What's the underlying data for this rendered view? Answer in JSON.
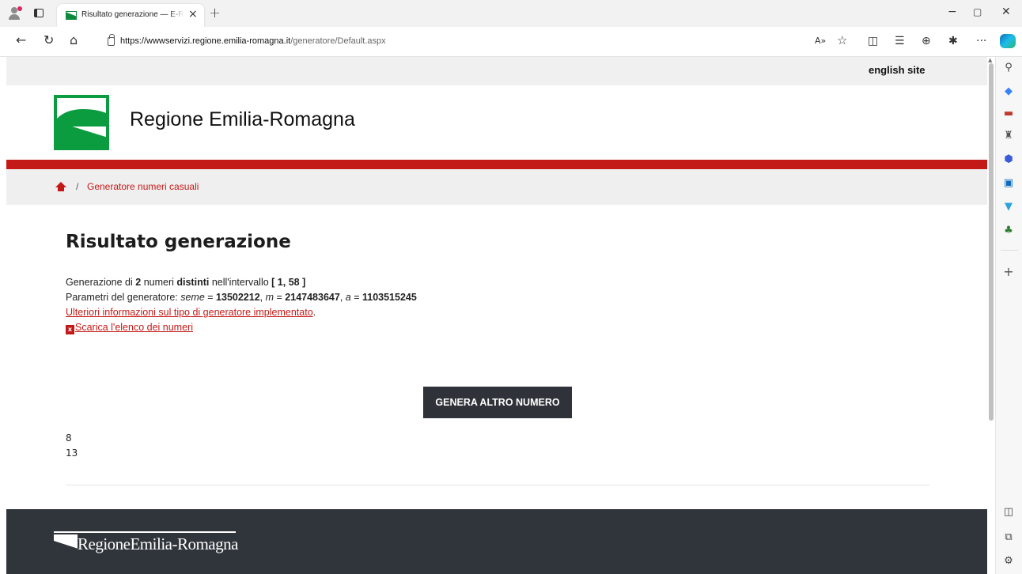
{
  "browser": {
    "tab_title": "Risultato generazione — E-R Il p",
    "tab_close": "×",
    "new_tab": "+",
    "url_host": "https://wwwservizi.regione.emilia-romagna.it",
    "url_path": "/generatore/Default.aspx",
    "window_controls": {
      "minimize": "−",
      "maximize": "▢",
      "close": "✕"
    },
    "nav": {
      "back": "←",
      "reload": "↻",
      "home": "⌂"
    },
    "toolbar": {
      "read_aloud": "A»",
      "favorite": "☆",
      "split": "◫",
      "favorites_bar": "☰",
      "collections": "⊕",
      "extensions": "✱",
      "more": "···"
    }
  },
  "page": {
    "top_link": "english site",
    "brand_name": "Regione Emilia-Romagna",
    "breadcrumb": {
      "separator": "/",
      "current": "Generatore numeri casuali"
    },
    "title": "Risultato generazione",
    "info": {
      "line1_a": "Generazione di ",
      "count": "2",
      "line1_b": " numeri ",
      "distinct": "distinti",
      "line1_c": " nell'intervallo ",
      "interval": "[ 1, 58 ]",
      "line2_a": "Parametri del generatore: ",
      "seme_label": "seme",
      "eq": " = ",
      "seme": "13502212",
      "m_label": "m",
      "m": "2147483647",
      "a_label": "a",
      "a": "1103515245",
      "comma": ", ",
      "more_info_link": "Ulteriori informazioni sul tipo di generatore implementato",
      "period": ".",
      "xls_icon": "x",
      "download_link": "Scarica l'elenco dei numeri"
    },
    "generate_button": "GENERA ALTRO NUMERO",
    "results": [
      "8",
      "13"
    ],
    "footer_brand": "RegioneEmilia-Romagna"
  },
  "colors": {
    "accent_red": "#c41a17",
    "brand_green": "#0a9c3f",
    "footer_bg": "#30353b",
    "button_bg": "#2f3339"
  }
}
